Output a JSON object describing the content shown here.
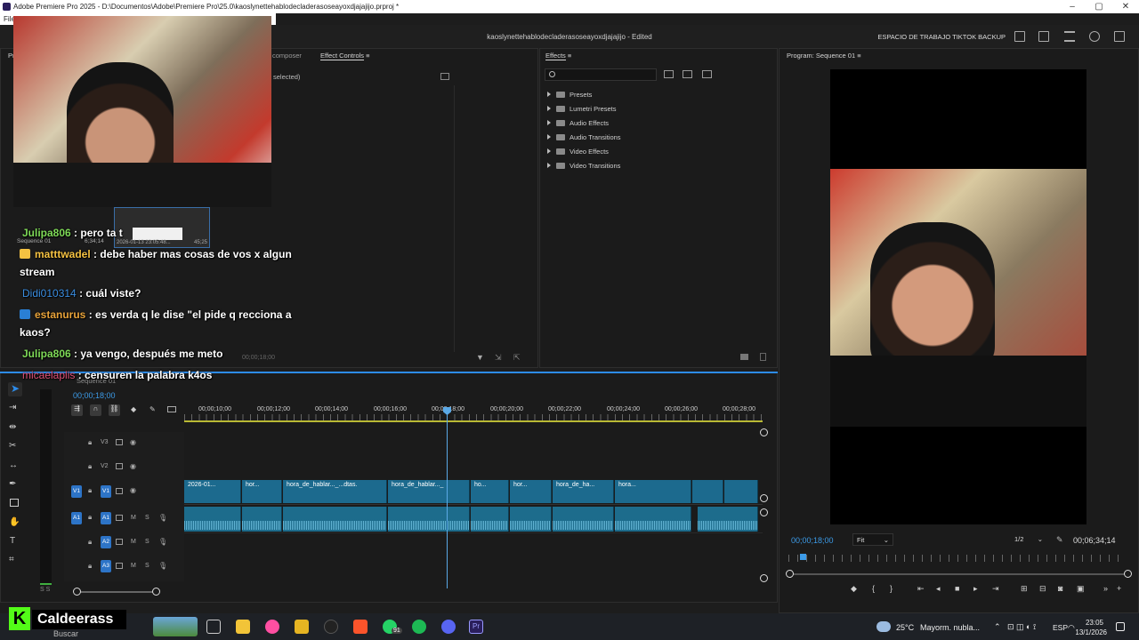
{
  "window": {
    "title": "Adobe Premiere Pro 2025 - D:\\Documentos\\Adobe\\Premiere Pro\\25.0\\kaoslynettehablodecladerasoseayoxdjajajijo.prproj *",
    "controls": [
      "–",
      "▢",
      "✕"
    ]
  },
  "menubar": {
    "items": [
      "File"
    ]
  },
  "header": {
    "project_title": "kaoslynettehablodecladerasoseayoxdjajajijo - Edited",
    "workspace": "ESPACIO DE TRABAJO TIKTOK BACKUP"
  },
  "source_panel": {
    "tabs": [
      "Pr",
      "composer",
      "Effect Controls"
    ],
    "active_tab": "Effect Controls",
    "no_clip_text": "selected)",
    "timecode": "00;00;18;00"
  },
  "effects_panel": {
    "title": "Effects",
    "search_placeholder": "",
    "items": [
      "Presets",
      "Lumetri Presets",
      "Audio Effects",
      "Audio Transitions",
      "Video Effects",
      "Video Transitions"
    ]
  },
  "project_thumb": {
    "name": "Sequence 01",
    "duration": "6;34;14",
    "date": "2026-01-13 23:05:48...",
    "time": "45;25"
  },
  "chat": [
    {
      "user": "Julipa806",
      "text": ": pero ta t",
      "color": "#7ed957"
    },
    {
      "user": "matttwadel",
      "text": ": debe haber mas cosas de vos x algun",
      "cont": "stream",
      "color": "#f5c242"
    },
    {
      "user": "Didi010314",
      "text": ": cuál viste?",
      "color": "#3a8de0"
    },
    {
      "user": "estanurus",
      "text": ": es verda q le dise \"el pide q recciona a",
      "cont": "kaos?",
      "color": "#e8a33a"
    },
    {
      "user": "Julipa806",
      "text": ": ya vengo, después me meto",
      "color": "#7ed957"
    },
    {
      "user": "micaelaplis",
      "text": ": censuren la palabra k4os",
      "color": "#e0507a"
    }
  ],
  "timeline": {
    "sequence": "Sequence 01",
    "timecode": "00;00;18;00",
    "ruler": [
      "00;00;10;00",
      "00;00;12;00",
      "00;00;14;00",
      "00;00;16;00",
      "00;00;18;00",
      "00;00;20;00",
      "00;00;22;00",
      "00;00;24;00",
      "00;00;26;00",
      "00;00;28;00"
    ],
    "tracks": [
      {
        "id": "V3",
        "type": "video"
      },
      {
        "id": "V2",
        "type": "video"
      },
      {
        "id": "V1",
        "type": "video"
      },
      {
        "id": "A1",
        "type": "audio"
      },
      {
        "id": "A2",
        "type": "audio"
      },
      {
        "id": "A3",
        "type": "audio"
      }
    ],
    "clips": [
      "2026-01...",
      "hor...",
      "hora_de_hablar..._...dtas.",
      "hora_de_hablar..._",
      "ho...",
      "hor...",
      "hora_de_ha...",
      "hora...",
      "",
      ""
    ],
    "mute_label": "M",
    "solo_label": "S",
    "meter_label": "S S"
  },
  "program_monitor": {
    "title": "Program: Sequence 01",
    "timecode": "00;00;18;00",
    "fit": "Fit",
    "resolution": "1/2",
    "duration": "00;06;34;14"
  },
  "overlay": {
    "brand": "Caldeerass",
    "brand_letter": "K"
  },
  "taskbar": {
    "search": "Buscar",
    "weather_temp": "25°C",
    "weather_text": "Mayorm. nubla...",
    "lang": "ESP",
    "time": "23:05",
    "date": "13/1/2026",
    "whatsapp_badge": "91"
  },
  "colors": {
    "accent_blue": "#2d8ceb",
    "clip_blue": "#1c6a8e",
    "playhead": "#5aa9e6"
  }
}
